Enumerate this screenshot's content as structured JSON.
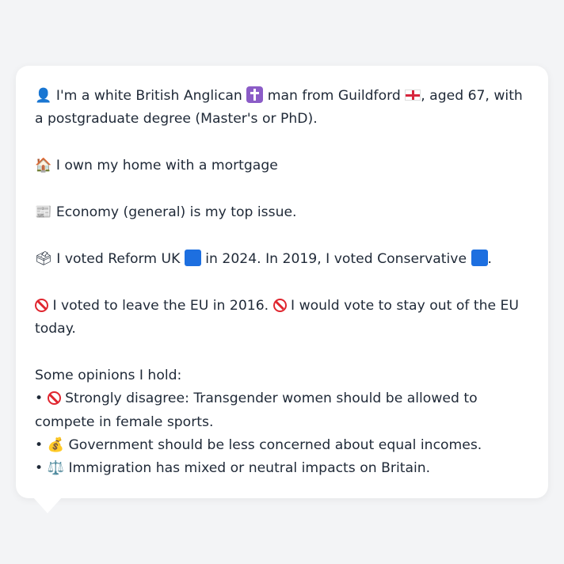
{
  "profile": {
    "intro": {
      "icon": "person-silhouette-icon",
      "text_before_religion": "I'm a white British Anglican",
      "religion_icon": "latin-cross-icon",
      "text_before_place": "man from Guildford",
      "place_icon": "england-flag-icon",
      "text_after_place": ", aged 67, with a postgraduate degree (Master's or PhD)."
    },
    "housing": {
      "icon": "house-icon",
      "glyph": "🏠",
      "text": "I own my home with a mortgage"
    },
    "issue": {
      "icon": "newspaper-icon",
      "glyph": "📰",
      "text": "Economy (general) is my top issue."
    },
    "vote": {
      "icon": "ballot-box-icon",
      "glyph": "🗳",
      "text_a": "I voted Reform UK",
      "party_2024_icon": "blue-square-icon",
      "text_b": "in 2024. In 2019, I voted Conservative",
      "party_2019_icon": "blue-square-icon",
      "text_c": "."
    },
    "eu": {
      "icon": "prohibited-icon",
      "text_a": "I voted to leave the EU in 2016.",
      "text_b": "I would vote to stay out of the EU today."
    },
    "opinions": {
      "heading": "Some opinions I hold:",
      "items": [
        {
          "bullet": "•",
          "icon": "prohibited-icon",
          "glyph": "",
          "text": "Strongly disagree: Transgender women should be allowed to compete in female sports."
        },
        {
          "bullet": "•",
          "icon": "money-bag-icon",
          "glyph": "💰",
          "text": "Government should be less concerned about equal incomes."
        },
        {
          "bullet": "•",
          "icon": "balance-scale-icon",
          "glyph": "⚖️",
          "text": "Immigration has mixed or neutral impacts on Britain."
        }
      ]
    }
  },
  "colors": {
    "background": "#f3f4f6",
    "card": "#ffffff",
    "text": "#1f2937",
    "party_blue": "#1d6fe0",
    "prohibited_red": "#e0262f"
  }
}
